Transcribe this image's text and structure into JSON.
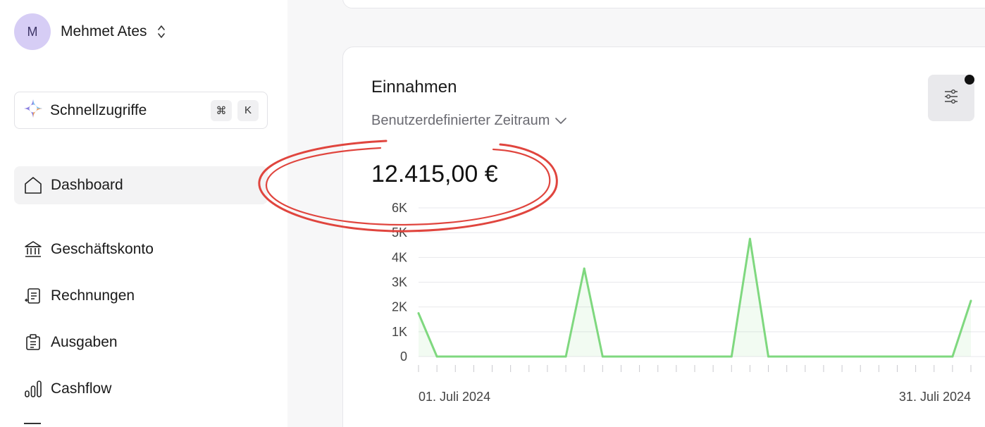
{
  "user": {
    "initial": "M",
    "name": "Mehmet Ates"
  },
  "quick_access": {
    "label": "Schnellzugriffe",
    "shortcut": [
      "⌘",
      "K"
    ]
  },
  "nav": [
    {
      "label": "Dashboard",
      "icon": "home-icon",
      "active": true
    },
    {
      "label": "Geschäftskonto",
      "icon": "bank-icon"
    },
    {
      "label": "Rechnungen",
      "icon": "invoice-icon"
    },
    {
      "label": "Ausgaben",
      "icon": "receipt-icon"
    },
    {
      "label": "Cashflow",
      "icon": "bar-chart-icon"
    }
  ],
  "card": {
    "title": "Einnahmen",
    "period": "Benutzerdefinierter Zeitraum",
    "amount": "12.415,00 €"
  },
  "colors": {
    "line": "#7fd87f",
    "annotation": "#e0453e",
    "avatar": "#d6cdf5"
  },
  "chart_data": {
    "type": "line",
    "x": [
      "2024-07-01",
      "2024-07-02",
      "2024-07-03",
      "2024-07-04",
      "2024-07-05",
      "2024-07-06",
      "2024-07-07",
      "2024-07-08",
      "2024-07-09",
      "2024-07-10",
      "2024-07-11",
      "2024-07-12",
      "2024-07-13",
      "2024-07-14",
      "2024-07-15",
      "2024-07-16",
      "2024-07-17",
      "2024-07-18",
      "2024-07-19",
      "2024-07-20",
      "2024-07-21",
      "2024-07-22",
      "2024-07-23",
      "2024-07-24",
      "2024-07-25",
      "2024-07-26",
      "2024-07-27",
      "2024-07-28",
      "2024-07-29",
      "2024-07-30",
      "2024-07-31"
    ],
    "values": [
      1750,
      0,
      0,
      0,
      0,
      0,
      0,
      0,
      0,
      3550,
      0,
      0,
      0,
      0,
      0,
      0,
      0,
      0,
      4750,
      0,
      0,
      0,
      0,
      0,
      0,
      0,
      0,
      0,
      0,
      0,
      2250
    ],
    "yticks": [
      "0",
      "1K",
      "2K",
      "3K",
      "4K",
      "5K",
      "6K"
    ],
    "ylim": [
      0,
      6000
    ],
    "xtick_labels": [
      "01. Juli 2024",
      "31. Juli 2024"
    ],
    "grid": true
  }
}
